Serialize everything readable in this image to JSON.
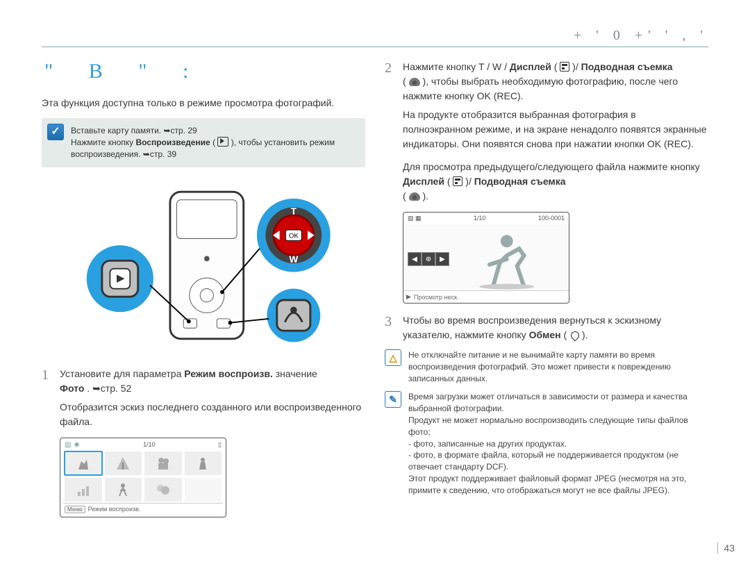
{
  "preheader": "+   '   0   +'  '  ,  '",
  "section_title": "\"   B  \" :",
  "intro": "Эта функция доступна только в режиме просмотра фотографий.",
  "tip": {
    "icon": "✓",
    "line1_a": "Вставьте карту памяти. ",
    "line1_b": "стр. 29",
    "line2_a": "Нажмите кнопку ",
    "line2_b": "Воспроизведение",
    "line2_c": " ( ",
    "line2_d": "), чтобы установить режим воспроизведения. ",
    "line2_e": "стр. 39"
  },
  "step1": {
    "num": "1",
    "a": "Установите для параметра ",
    "b": "Режим воспроизв.",
    "c": " значение ",
    "d": "Фото",
    "e": ". ",
    "f": "стр. 52",
    "sub": "Отобразится эскиз последнего созданного или воспроизведенного файла."
  },
  "thumbscreen": {
    "counter": "1/10",
    "bottom_label": "Режим воспроизв.",
    "bottom_btn": "Меню"
  },
  "step2": {
    "num": "2",
    "a": "Нажмите кнопку T / W /",
    "b": "Дисплей",
    "c": " ( ",
    "d": ")/",
    "e": "Подводная съемка",
    "f": "( ",
    "g": "), чтобы выбрать необходимую фотографию, после чего нажмите кнопку OK (REC).",
    "sub1": "На продукте отобразится выбранная фотография в полноэкранном режиме, и на экране ненадолго появятся экранные индикаторы. Они появятся снова при нажатии кнопки OK (REC).",
    "sub2a": "Для просмотра предыдущего/следующего файла нажмите кнопку ",
    "sub2b": "Дисплей",
    "sub2c": " ( ",
    "sub2d": ")/",
    "sub2e": "Подводная съемка",
    "sub2f": "( ",
    "sub2g": ")."
  },
  "singlescreen": {
    "counter": "1/10",
    "file": "100-0001",
    "bottom_label": "Просмотр неск.",
    "bottom_btn": "▶"
  },
  "step3": {
    "num": "3",
    "a": "Чтобы во время воспроизведения вернуться к эскизному указателю, нажмите кнопку ",
    "b": "Обмен",
    "c": " ( ",
    "d": ")."
  },
  "warn": {
    "icon": "△",
    "text": "Не отключайте питание и не вынимайте карту памяти во время воспроизведения фотографий. Это может привести к повреждению записанных данных."
  },
  "info": {
    "icon": "✎",
    "l1": "Время загрузки может отличаться в зависимости от размера и качества выбранной фотографии.",
    "l2": "Продукт не может нормально воспроизводить следующие типы файлов фото;",
    "l3": "- фото, записанные на других продуктах.",
    "l4": "- фото, в формате файла, который не поддерживается продуктом (не отвечает стандарту DCF).",
    "l5": "Этот продукт поддерживает файловый формат JPEG (несмотря на это, примите к сведению, что отображаться могут не все файлы JPEG)."
  },
  "page_number": "43"
}
